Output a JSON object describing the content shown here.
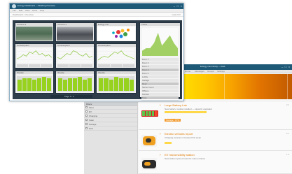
{
  "front_window": {
    "title": "Energy Dashboard — Building Overview",
    "menu": [
      "File",
      "Edit",
      "View",
      "Tools",
      "Help"
    ],
    "breadcrumb": "Dashboard › Overview",
    "breadcrumb_right": "Last 24 h",
    "tiles": [
      {
        "title": "Camera 1"
      },
      {
        "title": "Camera 2"
      },
      {
        "title": "Energy mix"
      },
      {
        "title": "Consumption"
      },
      {
        "title": "Consumption"
      },
      {
        "title": "Consumption"
      },
      {
        "title": "Weekly"
      },
      {
        "title": "Weekly"
      },
      {
        "title": "Weekly"
      }
    ],
    "side_panel": {
      "title": "Trend",
      "list": [
        "Floor 1",
        "Floor 2",
        "Floor 3",
        "Floor 4",
        "Floor 5",
        "Lobby",
        "Garage",
        "Roof",
        "Server room",
        "Offices",
        "Kitchen",
        "Total",
        "Export"
      ]
    },
    "pager": "Page 1 / 3"
  },
  "back_window": {
    "title": "Energy community — feed",
    "menu": [
      "Home",
      "Messages",
      "Groups",
      "Settings"
    ],
    "left_panel": {
      "header": "Filters",
      "items": [
        "Fleet",
        "EV",
        "Charging",
        "Solar",
        "Storage",
        "Grid"
      ]
    },
    "posts": [
      {
        "title": "Large Battery Lab",
        "meta": "2 h",
        "text": "New battery module installed — capacity upgraded",
        "tag": "Storage · 87%"
      },
      {
        "title": "Electric vehicles report",
        "meta": "5 h",
        "text": "Charging sessions increased this week",
        "tag": "EV"
      },
      {
        "title": "EV micromobility station",
        "meta": "1 d",
        "text": "New station opened near the main entrance",
        "tag": "Fleet"
      }
    ]
  },
  "chart_data": [
    {
      "type": "line",
      "x": [
        1,
        2,
        3,
        4,
        5,
        6,
        7,
        8,
        9,
        10,
        11,
        12
      ],
      "series": [
        {
          "values": [
            3,
            4,
            6,
            5,
            8,
            7,
            9,
            6,
            7,
            5,
            6,
            4
          ]
        }
      ],
      "color": "#8cc63f"
    },
    {
      "type": "line",
      "x": [
        1,
        2,
        3,
        4,
        5,
        6,
        7,
        8,
        9,
        10,
        11,
        12
      ],
      "series": [
        {
          "values": [
            4,
            3,
            5,
            7,
            6,
            9,
            8,
            6,
            5,
            7,
            4,
            5
          ]
        }
      ],
      "color": "#8cc63f"
    },
    {
      "type": "line",
      "x": [
        1,
        2,
        3,
        4,
        5,
        6,
        7,
        8,
        9,
        10,
        11,
        12
      ],
      "series": [
        {
          "values": [
            2,
            4,
            5,
            4,
            6,
            8,
            7,
            9,
            6,
            5,
            4,
            3
          ]
        }
      ],
      "color": "#8cc63f"
    },
    {
      "type": "area",
      "x": [
        1,
        2,
        3,
        4,
        5,
        6,
        7,
        8,
        9,
        10
      ],
      "series": [
        {
          "values": [
            2,
            3,
            3,
            5,
            9,
            4,
            6,
            8,
            5,
            3
          ]
        }
      ],
      "color": "#8cc63f"
    },
    {
      "type": "bar",
      "categories": [
        "1",
        "2",
        "3",
        "4",
        "5",
        "6",
        "7"
      ],
      "values": [
        8,
        9,
        9,
        8,
        9,
        10,
        9
      ],
      "color": "#96d21e"
    },
    {
      "type": "bar",
      "categories": [
        "1",
        "2",
        "3",
        "4",
        "5",
        "6",
        "7"
      ],
      "values": [
        9,
        8,
        9,
        9,
        10,
        8,
        9
      ],
      "color": "#96d21e"
    },
    {
      "type": "bar",
      "categories": [
        "1",
        "2",
        "3",
        "4",
        "5",
        "6",
        "7"
      ],
      "values": [
        9,
        9,
        8,
        10,
        9,
        9,
        8
      ],
      "color": "#96d21e"
    }
  ],
  "colors": {
    "titlebar": "#1e5a78",
    "dashboard_bg": "#2f3d4a",
    "accent_orange": "#e07a00",
    "series_green": "#8cc63f"
  }
}
